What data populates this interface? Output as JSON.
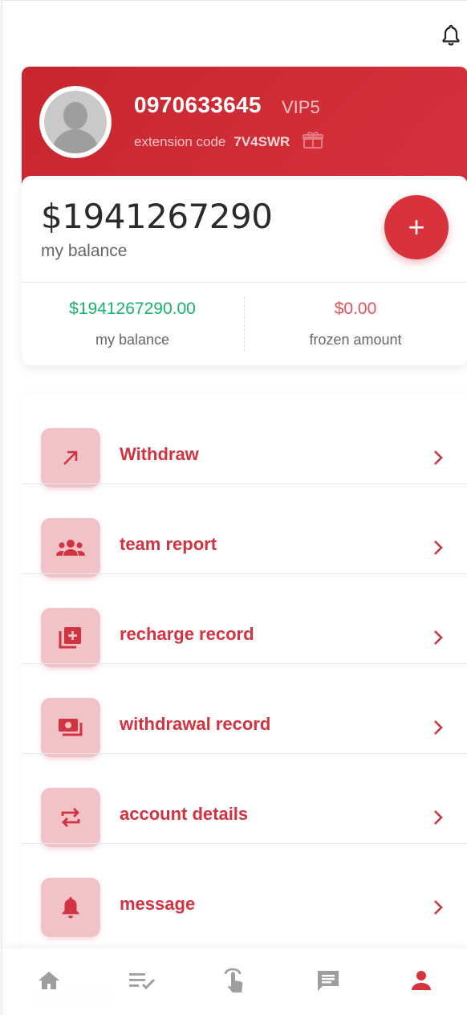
{
  "header": {
    "notification_icon": "bell-icon"
  },
  "profile": {
    "phone": "0970633645",
    "vip": "VIP5",
    "extension_label": "extension code",
    "extension_code": "7V4SWR",
    "gift_icon": "gift-icon",
    "avatar_icon": "default-avatar"
  },
  "balance": {
    "amount": "$1941267290",
    "label": "my balance",
    "add_button": "+",
    "stats": [
      {
        "value": "$1941267290.00",
        "label": "my balance"
      },
      {
        "value": "$0.00",
        "label": "frozen amount"
      }
    ]
  },
  "menu": [
    {
      "label": "Withdraw",
      "icon": "arrow-up-right-icon"
    },
    {
      "label": "team report",
      "icon": "team-icon"
    },
    {
      "label": "recharge record",
      "icon": "add-library-icon"
    },
    {
      "label": "withdrawal record",
      "icon": "cash-icon"
    },
    {
      "label": "account details",
      "icon": "swap-icon"
    },
    {
      "label": "message",
      "icon": "bell-icon"
    }
  ],
  "bottom_nav": [
    {
      "name": "home",
      "icon": "home-icon",
      "active": false
    },
    {
      "name": "tasks",
      "icon": "checklist-icon",
      "active": false
    },
    {
      "name": "grab",
      "icon": "tap-icon",
      "active": false
    },
    {
      "name": "messages",
      "icon": "chat-icon",
      "active": false
    },
    {
      "name": "profile",
      "icon": "person-icon",
      "active": true
    }
  ],
  "colors": {
    "primary": "#d8323d",
    "icon_bg": "#f2c3c6",
    "green": "#18b26b",
    "nav_inactive": "#9e9e9e"
  }
}
